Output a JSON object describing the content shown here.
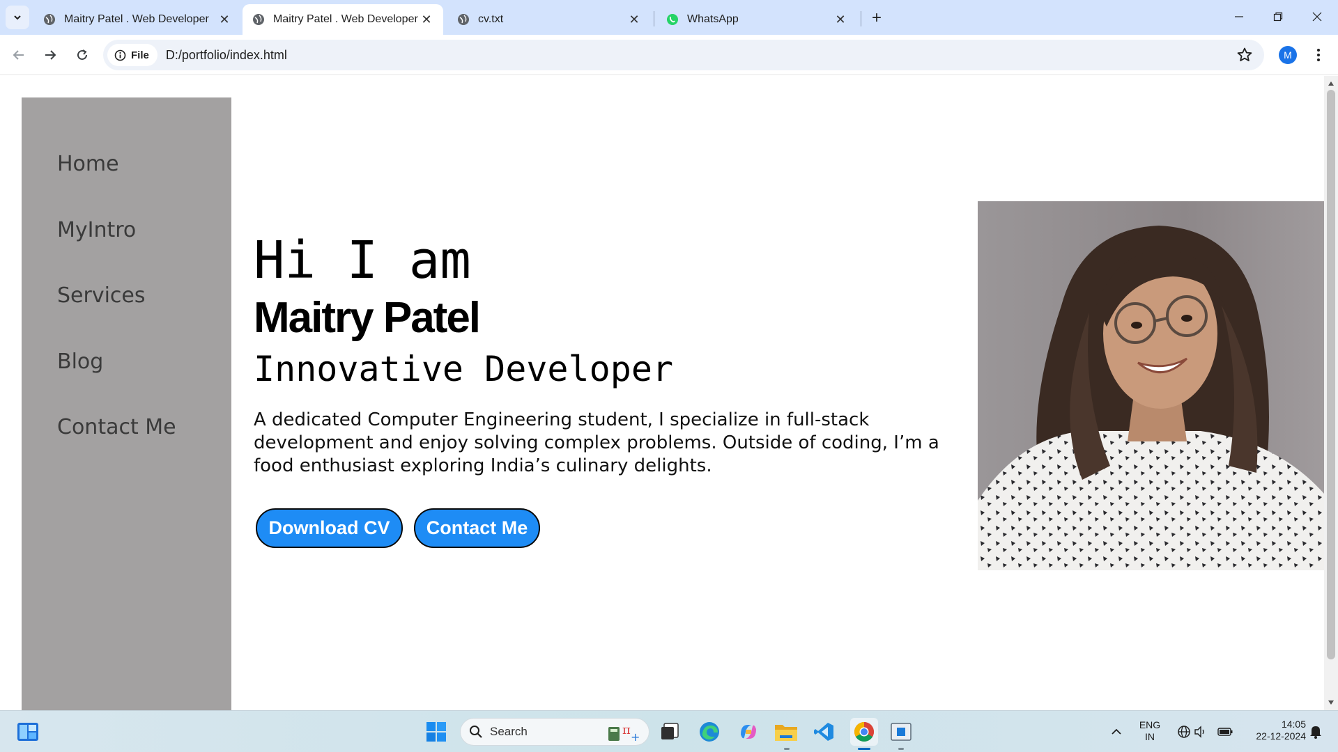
{
  "browser": {
    "tabs": [
      {
        "title": "Maitry Patel . Web Developer",
        "icon": "globe-icon",
        "active": false
      },
      {
        "title": "Maitry Patel . Web Developer",
        "icon": "globe-icon",
        "active": true
      },
      {
        "title": "cv.txt",
        "icon": "globe-icon",
        "active": false
      },
      {
        "title": "WhatsApp",
        "icon": "whatsapp-icon",
        "active": false
      }
    ],
    "site_chip_label": "File",
    "url": "D:/portfolio/index.html",
    "profile_initial": "M"
  },
  "page": {
    "sidebar": {
      "links": [
        "Home",
        "MyIntro",
        "Services",
        "Blog",
        "Contact Me"
      ]
    },
    "hero": {
      "greeting": "Hi I am",
      "name": "Maitry Patel",
      "role": "Innovative Developer",
      "bio": "A dedicated Computer Engineering student, I specialize in full-stack development and enjoy solving complex problems. Outside of coding, I’m a food enthusiast exploring India’s culinary delights.",
      "download_cv_label": "Download CV",
      "contact_label": "Contact Me"
    },
    "photo": "portrait-photo"
  },
  "taskbar": {
    "search_label": "Search",
    "language_line1": "ENG",
    "language_line2": "IN",
    "time": "14:05",
    "date": "22-12-2024"
  },
  "colors": {
    "sidebar_bg": "#a3a1a1",
    "button_bg": "#1e8cf5",
    "tabstrip_bg": "#d3e3fd"
  }
}
